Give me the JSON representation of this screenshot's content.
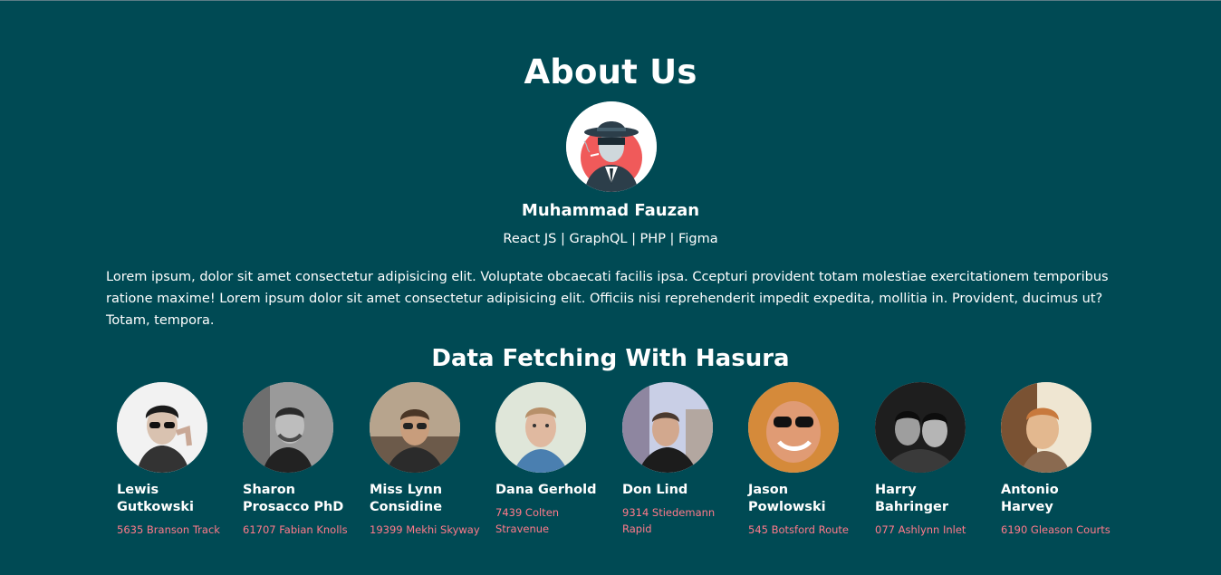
{
  "colors": {
    "background": "#004a54",
    "text": "#ffffff",
    "address": "#ff7a8a"
  },
  "about": {
    "title": "About Us",
    "name": "Muhammad Fauzan",
    "skills": "React JS | GraphQL | PHP | Figma",
    "paragraph": "Lorem ipsum, dolor sit amet consectetur adipisicing elit. Voluptate obcaecati facilis ipsa. Ccepturi provident totam molestiae exercitationem temporibus ratione maxime! Lorem ipsum dolor sit amet consectetur adipisicing elit. Officiis nisi reprehenderit impedit expedita, mollitia in. Provident, ducimus ut? Totam, tempora."
  },
  "section": {
    "title": "Data Fetching With Hasura"
  },
  "people": [
    {
      "name": "Lewis Gutkowski",
      "address": "5635 Branson Track"
    },
    {
      "name": "Sharon Prosacco PhD",
      "address": "61707 Fabian Knolls"
    },
    {
      "name": "Miss Lynn Considine",
      "address": "19399 Mekhi Skyway"
    },
    {
      "name": "Dana Gerhold",
      "address": "7439 Colten Stravenue"
    },
    {
      "name": "Don Lind",
      "address": "9314 Stiedemann Rapid"
    },
    {
      "name": "Jason Powlowski",
      "address": "545 Botsford Route"
    },
    {
      "name": "Harry Bahringer",
      "address": "077 Ashlynn Inlet"
    },
    {
      "name": "Antonio Harvey",
      "address": "6190 Gleason Courts"
    }
  ]
}
